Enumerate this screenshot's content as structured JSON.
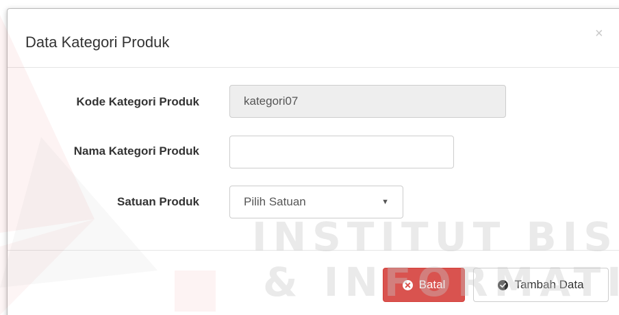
{
  "modal": {
    "title": "Data Kategori Produk",
    "close_symbol": "×"
  },
  "form": {
    "kode": {
      "label": "Kode Kategori Produk",
      "value": "kategori07"
    },
    "nama": {
      "label": "Nama Kategori Produk",
      "value": ""
    },
    "satuan": {
      "label": "Satuan Produk",
      "selected": "Pilih Satuan"
    }
  },
  "buttons": {
    "batal": "Batal",
    "tambah": "Tambah Data"
  },
  "watermark": {
    "line1": "INSTITUT BISNIS",
    "line2": "& INFORMATIKA"
  },
  "colors": {
    "danger": "#d9534f",
    "disabled_input": "#eeeeee",
    "border": "#cccccc"
  },
  "icons": {
    "batal": "times-circle-icon",
    "tambah": "check-circle-icon",
    "caret": "caret-down-icon"
  }
}
